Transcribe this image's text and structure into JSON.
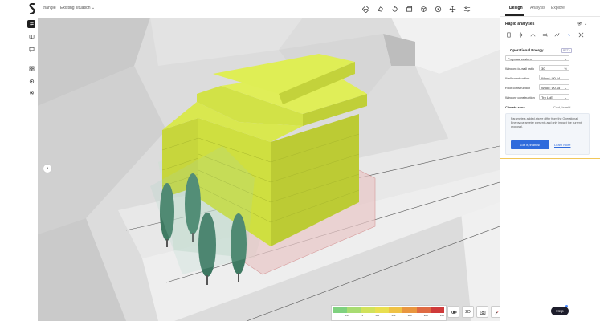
{
  "breadcrumb": {
    "project": "triangle",
    "scenario": "Existing situation"
  },
  "toolbar": {
    "tools": [
      {
        "name": "analysis-tool-icon"
      },
      {
        "name": "shape-tool-icon"
      },
      {
        "name": "rotate-tool-icon"
      },
      {
        "name": "layers-tool-icon"
      },
      {
        "name": "box-tool-icon"
      },
      {
        "name": "play-tool-icon"
      },
      {
        "name": "move-tool-icon"
      },
      {
        "name": "filter-tool-icon"
      }
    ]
  },
  "panel": {
    "tabs": [
      {
        "label": "Design"
      },
      {
        "label": "Analysis"
      },
      {
        "label": "Explore"
      }
    ],
    "rapid_title": "Rapid analyses",
    "op_energy_title": "Operational Energy",
    "beta": "BETA",
    "preset": "Proposal custom",
    "fields": [
      {
        "label": "Window-to-wall ratio",
        "value": "30",
        "unit": "%"
      },
      {
        "label": "Wall construction",
        "value": "Wood: U0.14"
      },
      {
        "label": "Roof construction",
        "value": "Wood: U0.15"
      },
      {
        "label": "Window construction",
        "value": "Trp LoE"
      }
    ],
    "climate_label": "Climate zone",
    "climate_value": "Cool, humid",
    "notice_text": "Parameters added above differ from the Operational Energy parameter presents and only impact the current proposal.",
    "notice_button": "Got it, thanks!",
    "notice_link": "Learn more"
  },
  "legend": {
    "colors": [
      "#7fd17f",
      "#a8dc72",
      "#d1e25b",
      "#e9df4f",
      "#efc245",
      "#e9963f",
      "#df6a43",
      "#cf3a3a"
    ],
    "ticks": [
      "",
      "29",
      "71",
      "100",
      "143",
      "186",
      "228",
      "250"
    ]
  },
  "viewport_controls": {
    "view_mode": "2D"
  },
  "help": {
    "label": "Help"
  },
  "colors": {
    "building": "#d6e64d",
    "accent": "#2f6bdc"
  }
}
